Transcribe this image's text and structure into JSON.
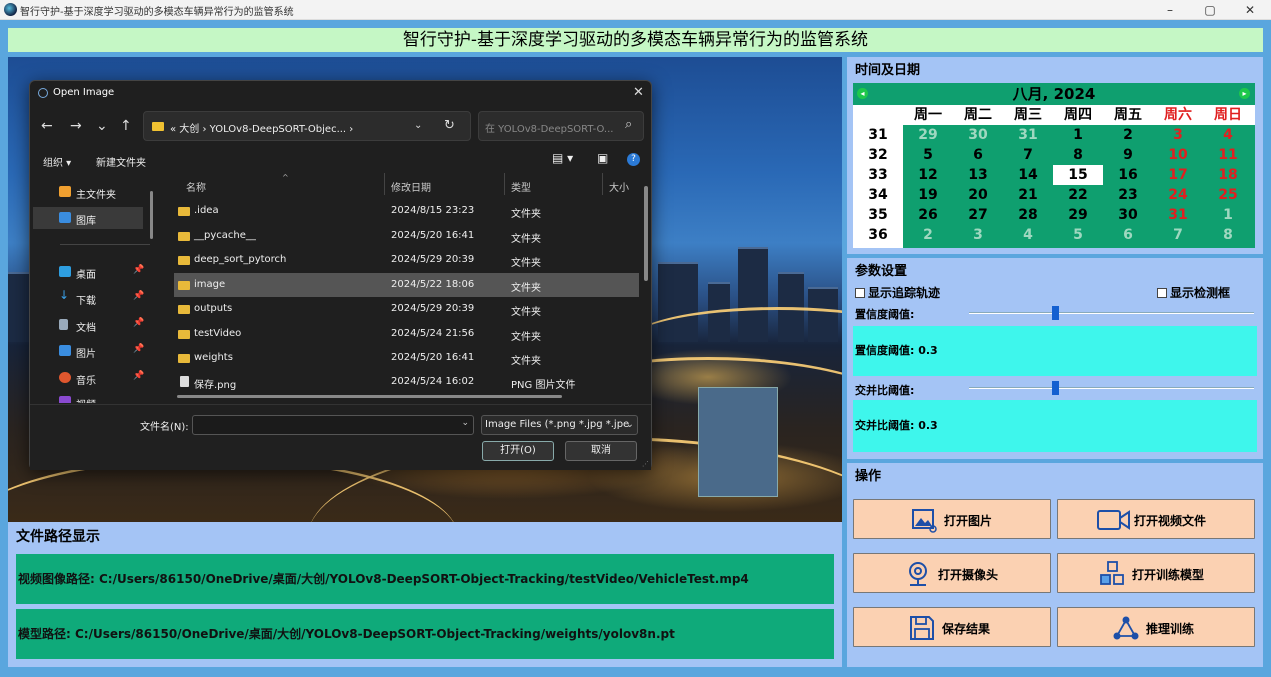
{
  "window": {
    "title": "智行守护-基于深度学习驱动的多模态车辆异常行为的监管系统",
    "minimize": "–",
    "maximize": "▢",
    "close": "✕"
  },
  "header": {
    "title": "智行守护-基于深度学习驱动的多模态车辆异常行为的监管系统"
  },
  "dialog": {
    "title": "Open Image",
    "close": "✕",
    "nav": {
      "back": "←",
      "forward": "→",
      "down": "⌄",
      "up": "↑"
    },
    "address": {
      "path": "« 大创 › YOLOv8-DeepSORT-Objec... ›",
      "chevron": "⌄",
      "refresh": "↻"
    },
    "search": {
      "placeholder": "在 YOLOv8-DeepSORT-O...",
      "icon": "⌕"
    },
    "toolbar": {
      "organize": "组织 ▾",
      "new_folder": "新建文件夹",
      "view": "▤ ▾",
      "pane": "▣",
      "help": "?"
    },
    "sidebar": [
      {
        "label": "主文件夹",
        "icon": "home-icon",
        "color": "#f0a030",
        "pinned": false
      },
      {
        "label": "图库",
        "icon": "gallery-icon",
        "color": "#3a8de0",
        "pinned": false
      },
      {
        "label": "桌面",
        "icon": "desktop-icon",
        "color": "#2e9ee0",
        "pinned": true
      },
      {
        "label": "下载",
        "icon": "download-icon",
        "color": "#3aa0e8",
        "pinned": true
      },
      {
        "label": "文档",
        "icon": "document-icon",
        "color": "#9ab",
        "pinned": true
      },
      {
        "label": "图片",
        "icon": "pictures-icon",
        "color": "#3a8de0",
        "pinned": true
      },
      {
        "label": "音乐",
        "icon": "music-icon",
        "color": "#e0572e",
        "pinned": true
      },
      {
        "label": "视频",
        "icon": "video-icon",
        "color": "#8a4ad0",
        "pinned": true
      }
    ],
    "pin": "📌",
    "columns": {
      "name": "名称",
      "date": "修改日期",
      "type": "类型",
      "size": "大小"
    },
    "files": [
      {
        "name": ".idea",
        "date": "2024/8/15 23:23",
        "type": "文件夹",
        "selected": false
      },
      {
        "name": "__pycache__",
        "date": "2024/5/20 16:41",
        "type": "文件夹",
        "selected": false
      },
      {
        "name": "deep_sort_pytorch",
        "date": "2024/5/29 20:39",
        "type": "文件夹",
        "selected": false
      },
      {
        "name": "image",
        "date": "2024/5/22 18:06",
        "type": "文件夹",
        "selected": true
      },
      {
        "name": "outputs",
        "date": "2024/5/29 20:39",
        "type": "文件夹",
        "selected": false
      },
      {
        "name": "testVideo",
        "date": "2024/5/24 21:56",
        "type": "文件夹",
        "selected": false
      },
      {
        "name": "weights",
        "date": "2024/5/20 16:41",
        "type": "文件夹",
        "selected": false
      },
      {
        "name": "保存.png",
        "date": "2024/5/24 16:02",
        "type": "PNG 图片文件",
        "selected": false
      }
    ],
    "filename_label": "文件名(N):",
    "filename_value": "",
    "filetype": "Image Files (*.png *.jpg *.jpe",
    "open_button": "打开(O)",
    "cancel_button": "取消"
  },
  "path_section": {
    "title": "文件路径显示",
    "video_path": "视频图像路径: C:/Users/86150/OneDrive/桌面/大创/YOLOv8-DeepSORT-Object-Tracking/testVideo/VehicleTest.mp4",
    "model_path": "模型路径: C:/Users/86150/OneDrive/桌面/大创/YOLOv8-DeepSORT-Object-Tracking/weights/yolov8n.pt"
  },
  "date_panel": {
    "title": "时间及日期",
    "month_year": "八月, 2024",
    "weekdays": [
      "周一",
      "周二",
      "周三",
      "周四",
      "周五",
      "周六",
      "周日"
    ],
    "weeks": [
      {
        "wk": "31",
        "days": [
          "29",
          "30",
          "31",
          "1",
          "2",
          "3",
          "4"
        ]
      },
      {
        "wk": "32",
        "days": [
          "5",
          "6",
          "7",
          "8",
          "9",
          "10",
          "11"
        ]
      },
      {
        "wk": "33",
        "days": [
          "12",
          "13",
          "14",
          "15",
          "16",
          "17",
          "18"
        ]
      },
      {
        "wk": "34",
        "days": [
          "19",
          "20",
          "21",
          "22",
          "23",
          "24",
          "25"
        ]
      },
      {
        "wk": "35",
        "days": [
          "26",
          "27",
          "28",
          "29",
          "30",
          "31",
          "1"
        ]
      },
      {
        "wk": "36",
        "days": [
          "2",
          "3",
          "4",
          "5",
          "6",
          "7",
          "8"
        ]
      }
    ],
    "today": "15",
    "colors": {
      "header": "#0f9f6f",
      "weekend": "#e02020",
      "other_month": "#9fd8c0"
    }
  },
  "params": {
    "title": "参数设置",
    "show_track": "显示追踪轨迹",
    "show_box": "显示检测框",
    "conf_label": "置信度阈值:",
    "conf_value_text": "置信度阈值: 0.3",
    "conf_value": 0.3,
    "iou_label": "交并比阈值:",
    "iou_value_text": "交并比阈值: 0.3",
    "iou_value": 0.3
  },
  "ops": {
    "title": "操作",
    "open_image": "打开图片",
    "open_video": "打开视频文件",
    "open_camera": "打开摄像头",
    "open_model": "打开训练模型",
    "save_result": "保存结果",
    "infer_train": "推理训练",
    "button_color": "#fbd1b2"
  }
}
